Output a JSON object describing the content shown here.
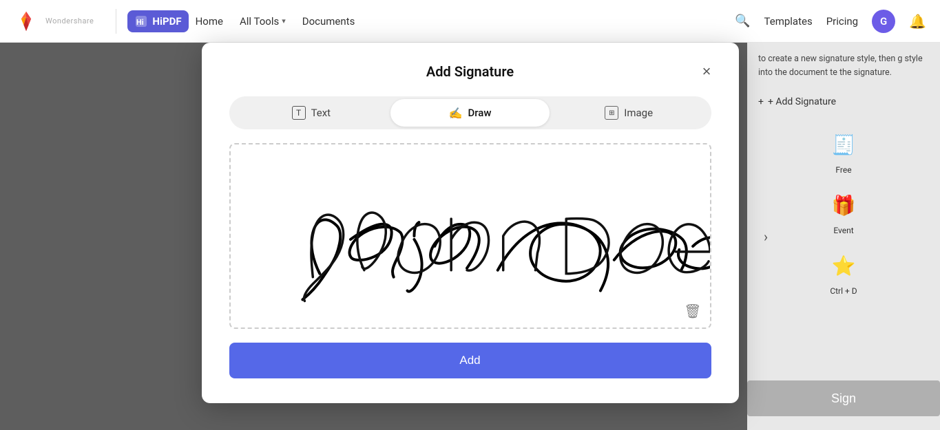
{
  "navbar": {
    "brand": "Wondershare",
    "app_name": "HiPDF",
    "nav_links": [
      {
        "label": "Home",
        "id": "home"
      },
      {
        "label": "All Tools",
        "id": "all-tools",
        "has_chevron": true
      },
      {
        "label": "Documents",
        "id": "documents"
      }
    ],
    "right_links": [
      {
        "label": "Templates",
        "id": "templates"
      },
      {
        "label": "Pricing",
        "id": "pricing"
      }
    ],
    "avatar_letter": "G",
    "search_icon": "🔍"
  },
  "sidebar": {
    "hint_text": "to create a new signature style, then g style into the document te the signature.",
    "add_signature_label": "+ Add Signature",
    "free_label": "Free",
    "event_label": "Event",
    "ctrl_d_label": "Ctrl + D",
    "chevron": "›",
    "sign_label": "Sign"
  },
  "modal": {
    "title": "Add Signature",
    "close_label": "×",
    "tabs": [
      {
        "id": "text",
        "label": "Text",
        "icon": "T"
      },
      {
        "id": "draw",
        "label": "Draw",
        "icon": "✍"
      },
      {
        "id": "image",
        "label": "Image",
        "icon": "🖼"
      }
    ],
    "active_tab": "draw",
    "signature_placeholder": "John Doe",
    "add_button_label": "Add",
    "trash_icon": "🗑"
  }
}
